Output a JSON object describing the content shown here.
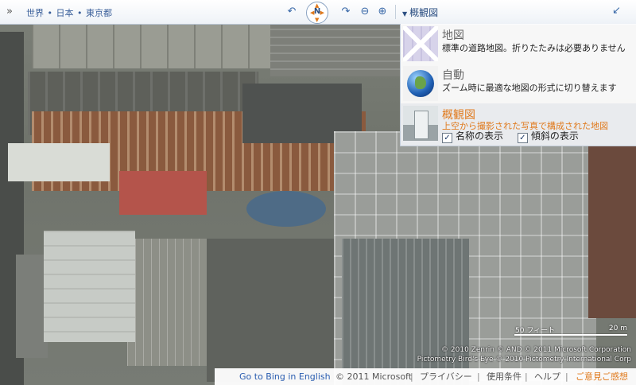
{
  "breadcrumb": {
    "items": [
      "世界",
      "日本",
      "東京都"
    ],
    "separator": "•"
  },
  "nav": {
    "compass_label": "N"
  },
  "view_dropdown": {
    "label": "概観図"
  },
  "view_options": [
    {
      "title": "地図",
      "description": "標準の道路地図。折りたたみは必要ありません",
      "selected": false,
      "icon": "road-map-thumbnail"
    },
    {
      "title": "自動",
      "description": "ズーム時に最適な地図の形式に切り替えます",
      "selected": false,
      "icon": "globe-thumbnail"
    },
    {
      "title": "概観図",
      "description": "上空から撮影された写真で構成された地図",
      "selected": true,
      "icon": "birds-eye-thumbnail"
    }
  ],
  "checkboxes": [
    {
      "label": "名称の表示",
      "checked": true
    },
    {
      "label": "傾斜の表示",
      "checked": true
    }
  ],
  "scale": {
    "label_imperial": "50 フィート",
    "label_metric": "20 m"
  },
  "copyright": {
    "line1": "© 2010 Zenrin   © AND   © 2011 Microsoft Corporation",
    "line2": "Pictometry Bird's Eye © 2010 Pictometry International Corp"
  },
  "footer": {
    "english_link": "Go to Bing in English",
    "copyright": "© 2011 Microsoft",
    "privacy": "プライバシー",
    "terms": "使用条件",
    "help": "ヘルプ",
    "feedback": "ご意見ご感想",
    "separator": "|"
  },
  "colors": {
    "accent_orange": "#e07a1d",
    "link_blue": "#2a5db0"
  }
}
